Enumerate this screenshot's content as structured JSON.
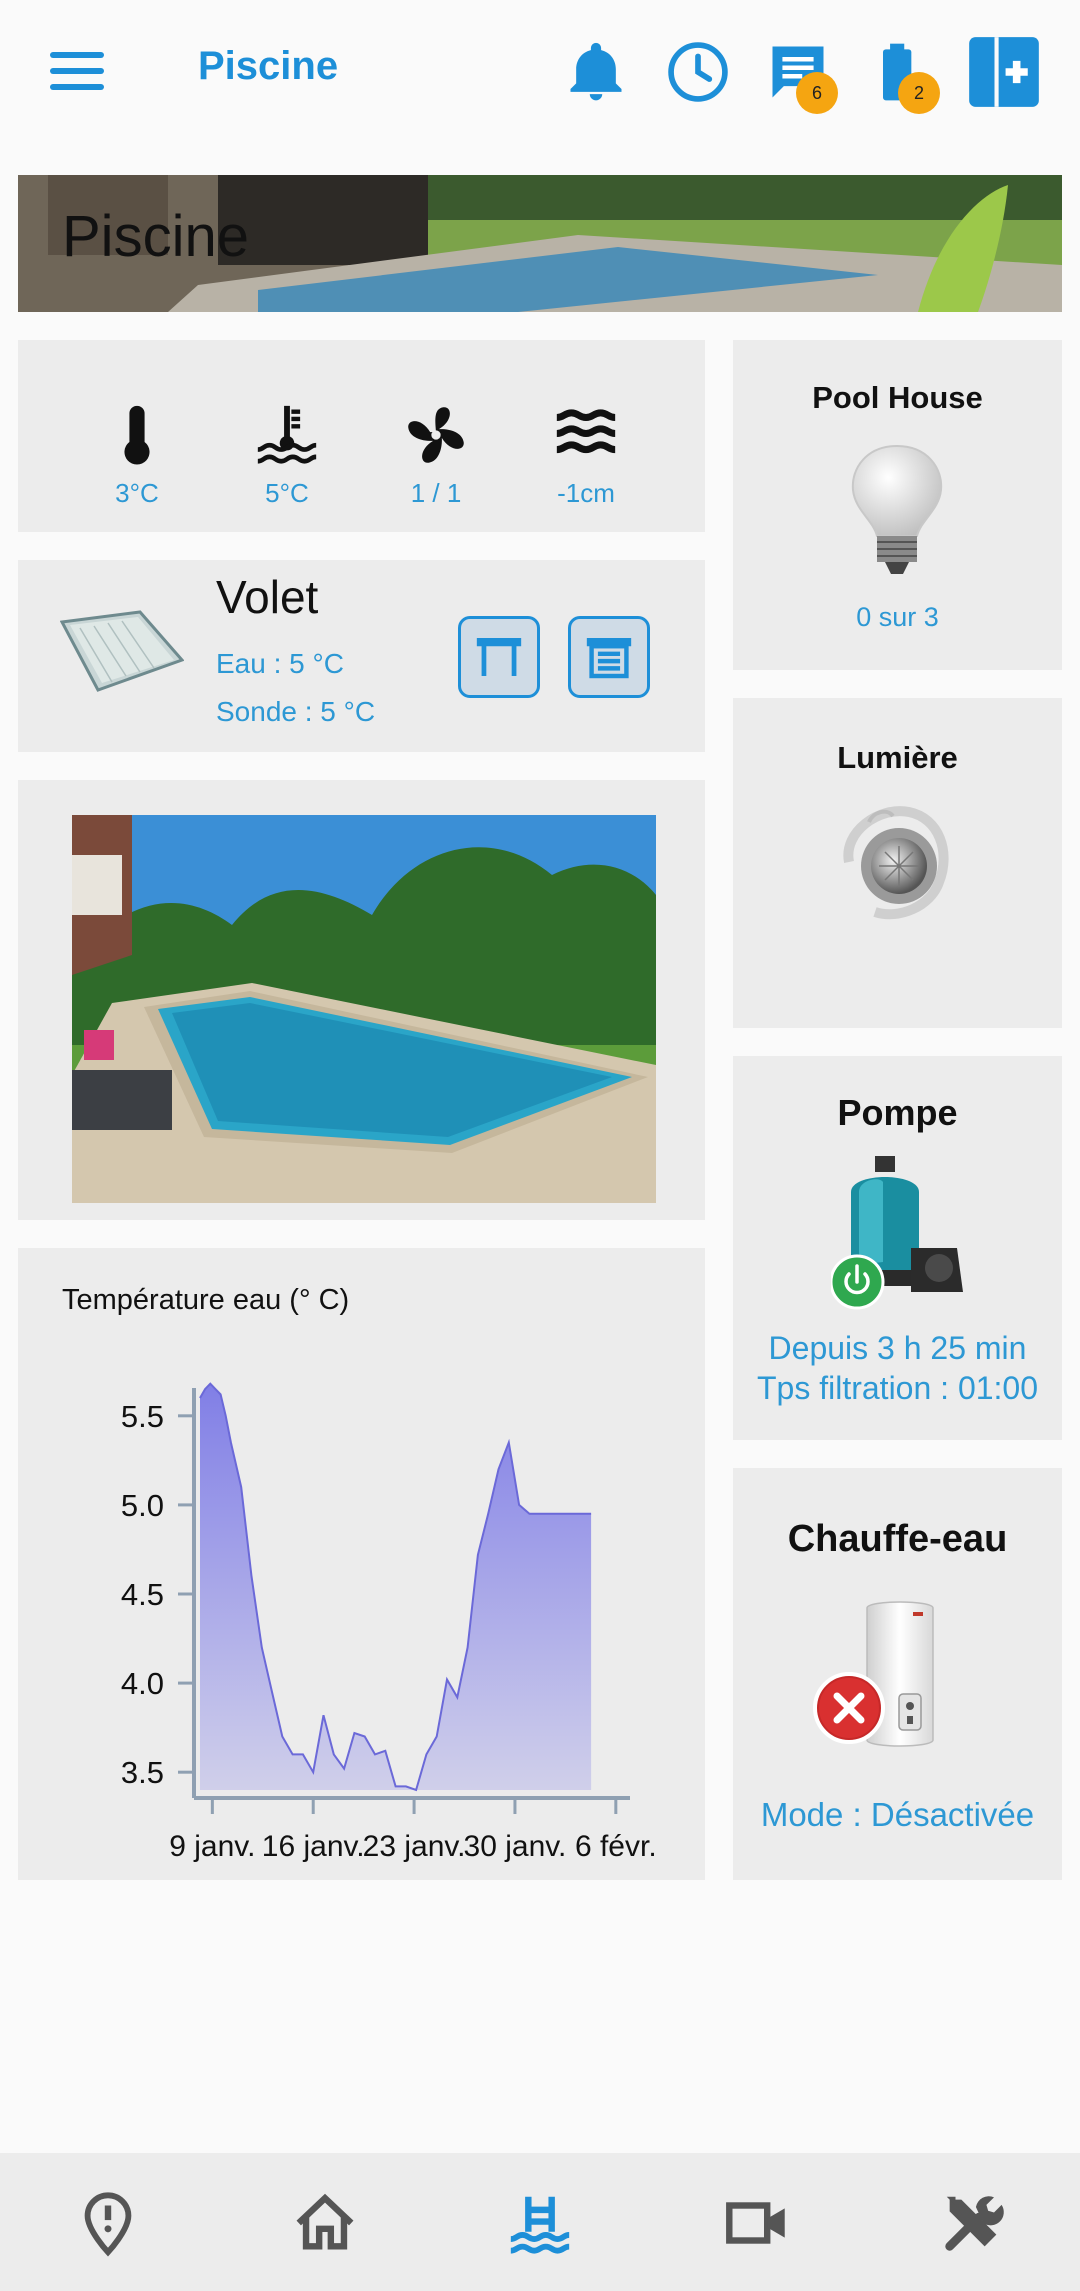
{
  "header": {
    "title": "Piscine",
    "messages_badge": "6",
    "battery_badge": "2",
    "icons": [
      "menu-icon",
      "bell-icon",
      "clock-icon",
      "message-icon",
      "battery-icon",
      "add-icon"
    ]
  },
  "banner": {
    "title": "Piscine"
  },
  "sensors": {
    "items": [
      {
        "icon": "thermometer-icon",
        "value": "3°C"
      },
      {
        "icon": "water-temperature-icon",
        "value": "5°C"
      },
      {
        "icon": "fan-icon",
        "value": "1 / 1"
      },
      {
        "icon": "water-level-icon",
        "value": "-1cm"
      }
    ]
  },
  "volet": {
    "title": "Volet",
    "eau": "Eau : 5 °C",
    "sonde": "Sonde : 5 °C",
    "buttons": [
      "volet-open-icon",
      "volet-close-icon"
    ]
  },
  "chart": {
    "title": "Température eau (° C)"
  },
  "chart_data": {
    "type": "area",
    "title": "Température eau (° C)",
    "xlabel": "",
    "ylabel": "",
    "x_ticks": [
      "9 janv.",
      "16 janv.",
      "23 janv.",
      "30 janv.",
      "6 févr."
    ],
    "y_ticks": [
      3.5,
      4.0,
      4.5,
      5.0,
      5.5
    ],
    "ylim": [
      3.4,
      5.6
    ],
    "xlim": [
      0,
      41
    ],
    "x": [
      0,
      0.5,
      1,
      1.5,
      2,
      2.5,
      3,
      4,
      5,
      6,
      7,
      8,
      9,
      10,
      11,
      12,
      13,
      14,
      15,
      16,
      17,
      18,
      19,
      20,
      21,
      22,
      23,
      24,
      25,
      26,
      27,
      28,
      29,
      30,
      31,
      32,
      33,
      34,
      35,
      36,
      37,
      37.5,
      38
    ],
    "values": [
      5.6,
      5.65,
      5.68,
      5.65,
      5.62,
      5.5,
      5.35,
      5.1,
      4.6,
      4.2,
      3.95,
      3.7,
      3.6,
      3.6,
      3.5,
      3.82,
      3.6,
      3.52,
      3.72,
      3.7,
      3.6,
      3.62,
      3.42,
      3.42,
      3.4,
      3.6,
      3.7,
      4.02,
      3.92,
      4.2,
      4.72,
      4.95,
      5.2,
      5.35,
      5.0,
      4.95,
      4.95,
      4.95,
      4.95,
      4.95,
      4.95,
      4.95,
      4.95
    ],
    "series_color": "#7b79e6",
    "grid": false
  },
  "pool_house": {
    "title": "Pool House",
    "status": "0 sur 3",
    "icon": "light-bulb-icon"
  },
  "lumiere": {
    "title": "Lumière",
    "icon": "pool-light-icon"
  },
  "pompe": {
    "title": "Pompe",
    "line1": "Depuis 3 h 25 min",
    "line2": "Tps filtration : 01:00",
    "icon": "pool-pump-icon"
  },
  "chauffe": {
    "title": "Chauffe-eau",
    "mode": "Mode : Désactivée",
    "icon": "water-heater-icon"
  },
  "nav": {
    "items": [
      "map-pin-icon",
      "home-icon",
      "pool-icon",
      "camera-icon",
      "tools-icon"
    ],
    "active": "pool-icon",
    "active_color": "#1d8fd8",
    "inactive_color": "#555555"
  },
  "colors": {
    "accent": "#1d8fd8",
    "value_text": "#2d98d4",
    "badge": "#f5a511",
    "card": "#ececec"
  }
}
